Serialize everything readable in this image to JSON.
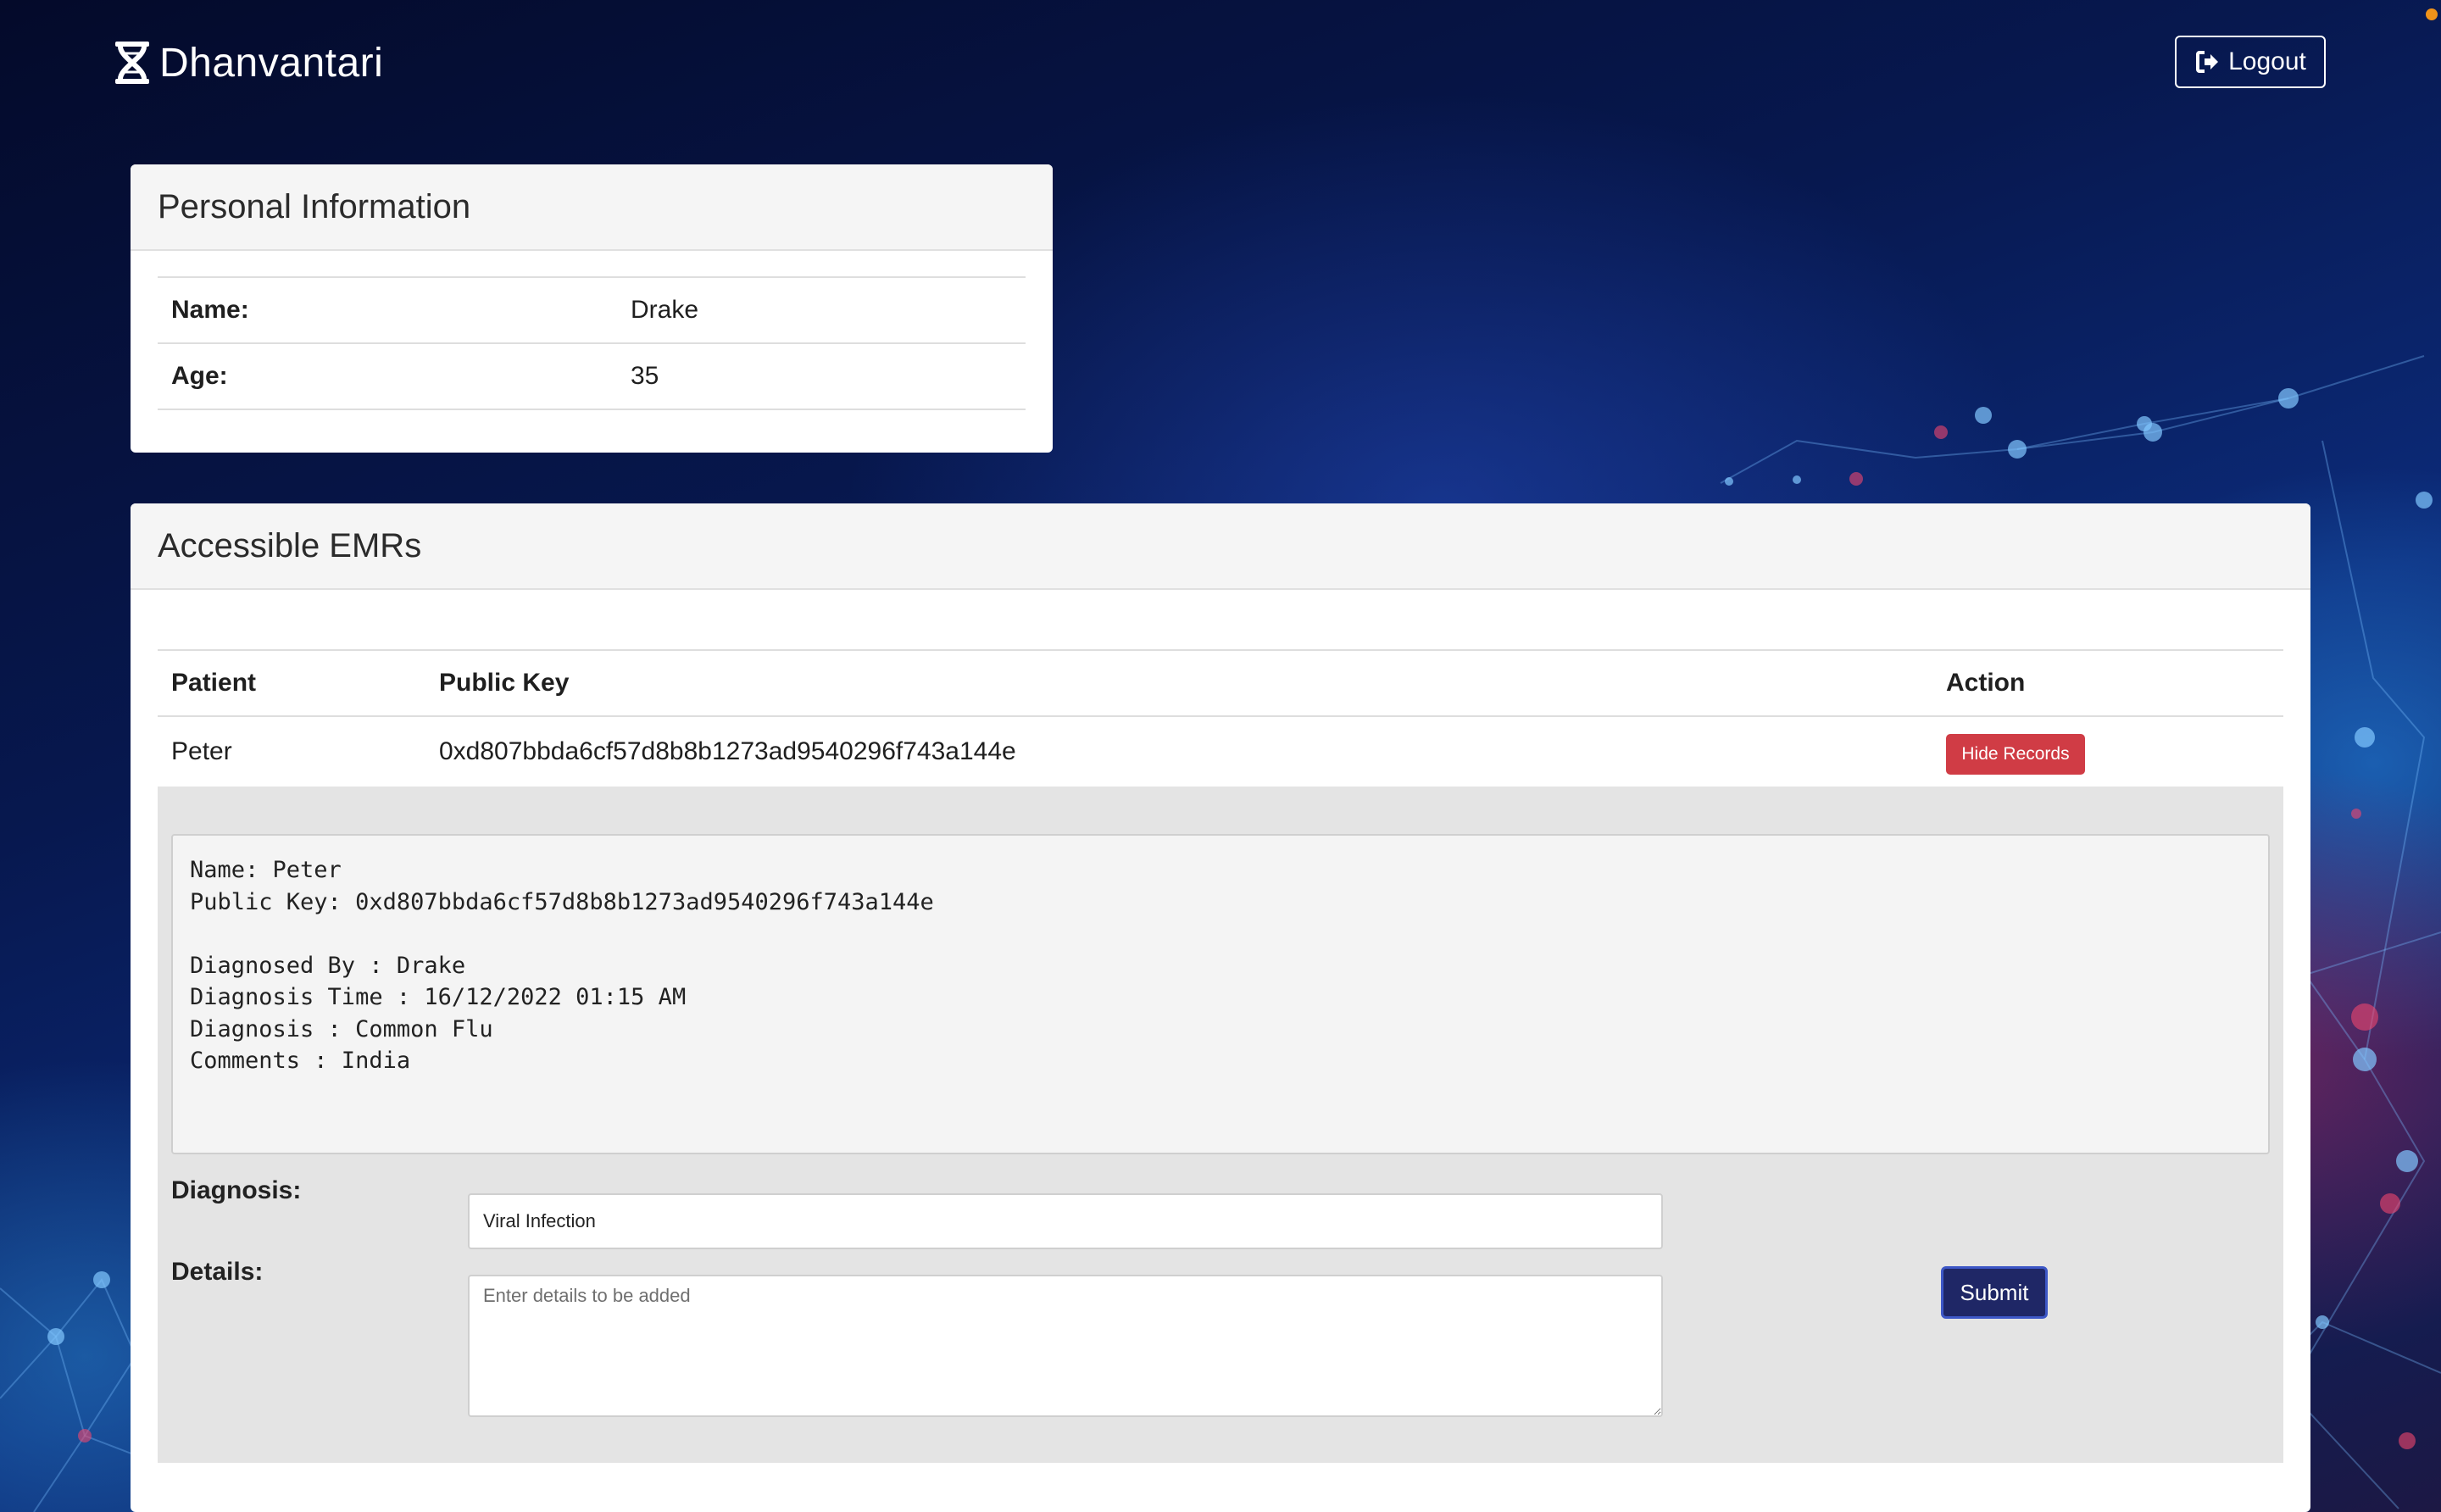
{
  "brand": {
    "name": "Dhanvantari",
    "logo_icon": "hourglass-dna-icon"
  },
  "header": {
    "logout_label": "Logout",
    "logout_icon": "sign-out-icon"
  },
  "personal_info": {
    "title": "Personal Information",
    "rows": [
      {
        "label": "Name:",
        "value": "Drake"
      },
      {
        "label": "Age:",
        "value": "35"
      }
    ]
  },
  "emrs": {
    "title": "Accessible EMRs",
    "columns": {
      "patient": "Patient",
      "public_key": "Public Key",
      "action": "Action"
    },
    "rows": [
      {
        "patient": "Peter",
        "public_key": "0xd807bbda6cf57d8b8b1273ad9540296f743a144e",
        "action_label": "Hide Records"
      }
    ],
    "record": {
      "text": "Name: Peter\nPublic Key: 0xd807bbda6cf57d8b8b1273ad9540296f743a144e\n\nDiagnosed By : Drake\nDiagnosis Time : 16/12/2022 01:15 AM\nDiagnosis : Common Flu\nComments : India"
    },
    "form": {
      "diagnosis_label": "Diagnosis:",
      "diagnosis_value": "Viral Infection",
      "details_label": "Details:",
      "details_placeholder": "Enter details to be added",
      "submit_label": "Submit"
    }
  },
  "colors": {
    "hide_button": "#d03c45",
    "submit_button": "#1f2766",
    "background_top": "#040a2a"
  }
}
